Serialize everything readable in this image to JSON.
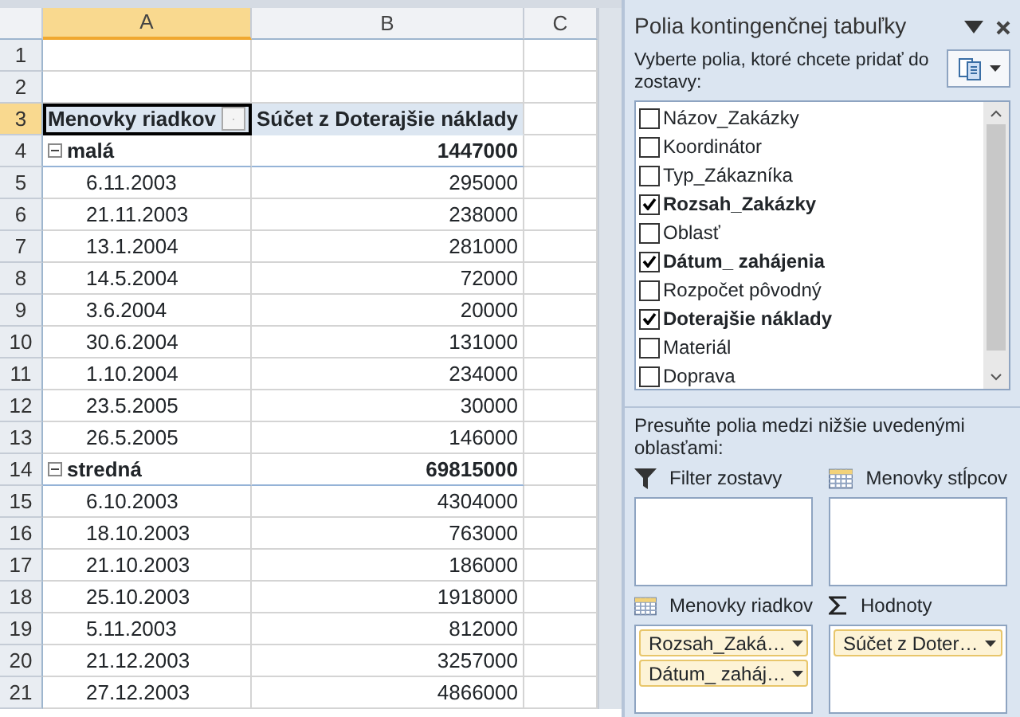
{
  "sheet": {
    "columns": [
      {
        "label": "A",
        "selected": true
      },
      {
        "label": "B",
        "selected": false
      },
      {
        "label": "C",
        "selected": false
      }
    ],
    "rows": [
      {
        "number": "1",
        "selected": false,
        "kind": "empty",
        "cells": []
      },
      {
        "number": "2",
        "selected": false,
        "kind": "empty",
        "cells": []
      },
      {
        "number": "3",
        "selected": true,
        "kind": "header",
        "cells": [
          "Menovky riadkov",
          "Súčet z Doterajšie náklady"
        ]
      },
      {
        "number": "4",
        "selected": false,
        "kind": "group",
        "expanded": true,
        "cells": [
          "malá",
          "1447000"
        ]
      },
      {
        "number": "5",
        "selected": false,
        "kind": "item",
        "cells": [
          "6.11.2003",
          "295000"
        ]
      },
      {
        "number": "6",
        "selected": false,
        "kind": "item",
        "cells": [
          "21.11.2003",
          "238000"
        ]
      },
      {
        "number": "7",
        "selected": false,
        "kind": "item",
        "cells": [
          "13.1.2004",
          "281000"
        ]
      },
      {
        "number": "8",
        "selected": false,
        "kind": "item",
        "cells": [
          "14.5.2004",
          "72000"
        ]
      },
      {
        "number": "9",
        "selected": false,
        "kind": "item",
        "cells": [
          "3.6.2004",
          "20000"
        ]
      },
      {
        "number": "10",
        "selected": false,
        "kind": "item",
        "cells": [
          "30.6.2004",
          "131000"
        ]
      },
      {
        "number": "11",
        "selected": false,
        "kind": "item",
        "cells": [
          "1.10.2004",
          "234000"
        ]
      },
      {
        "number": "12",
        "selected": false,
        "kind": "item",
        "cells": [
          "23.5.2005",
          "30000"
        ]
      },
      {
        "number": "13",
        "selected": false,
        "kind": "item",
        "cells": [
          "26.5.2005",
          "146000"
        ]
      },
      {
        "number": "14",
        "selected": false,
        "kind": "group",
        "expanded": true,
        "cells": [
          "stredná",
          "69815000"
        ]
      },
      {
        "number": "15",
        "selected": false,
        "kind": "item",
        "cells": [
          "6.10.2003",
          "4304000"
        ]
      },
      {
        "number": "16",
        "selected": false,
        "kind": "item",
        "cells": [
          "18.10.2003",
          "763000"
        ]
      },
      {
        "number": "17",
        "selected": false,
        "kind": "item",
        "cells": [
          "21.10.2003",
          "186000"
        ]
      },
      {
        "number": "18",
        "selected": false,
        "kind": "item",
        "cells": [
          "25.10.2003",
          "1918000"
        ]
      },
      {
        "number": "19",
        "selected": false,
        "kind": "item",
        "cells": [
          "5.11.2003",
          "812000"
        ]
      },
      {
        "number": "20",
        "selected": false,
        "kind": "item",
        "cells": [
          "21.12.2003",
          "3257000"
        ]
      },
      {
        "number": "21",
        "selected": false,
        "kind": "item",
        "cells": [
          "27.12.2003",
          "4866000"
        ]
      }
    ]
  },
  "panel": {
    "title": "Polia kontingenčnej tabuľky",
    "instruction": "Vyberte polia, ktoré chcete pridať do zostavy:",
    "fields": [
      {
        "label": "Názov_Zakázky",
        "checked": false
      },
      {
        "label": "Koordinátor",
        "checked": false
      },
      {
        "label": "Typ_Zákazníka",
        "checked": false
      },
      {
        "label": "Rozsah_Zakázky",
        "checked": true
      },
      {
        "label": "Oblasť",
        "checked": false
      },
      {
        "label": "Dátum_ zahájenia",
        "checked": true
      },
      {
        "label": "Rozpočet pôvodný",
        "checked": false
      },
      {
        "label": "Doterajšie náklady",
        "checked": true
      },
      {
        "label": "Materiál",
        "checked": false
      },
      {
        "label": "Doprava",
        "checked": false
      }
    ],
    "areas_hint": "Presuňte polia medzi nižšie uvedenými oblasťami:",
    "areas": [
      {
        "kind": "filter",
        "title": "Filter zostavy"
      },
      {
        "kind": "columns",
        "title": "Menovky stĺpcov"
      },
      {
        "kind": "rows",
        "title": "Menovky riadkov",
        "items": [
          "Rozsah_Zaká…",
          "Dátum_ zaháj…"
        ]
      },
      {
        "kind": "values",
        "title": "Hodnoty",
        "items": [
          "Súčet z Doter…"
        ]
      }
    ]
  }
}
